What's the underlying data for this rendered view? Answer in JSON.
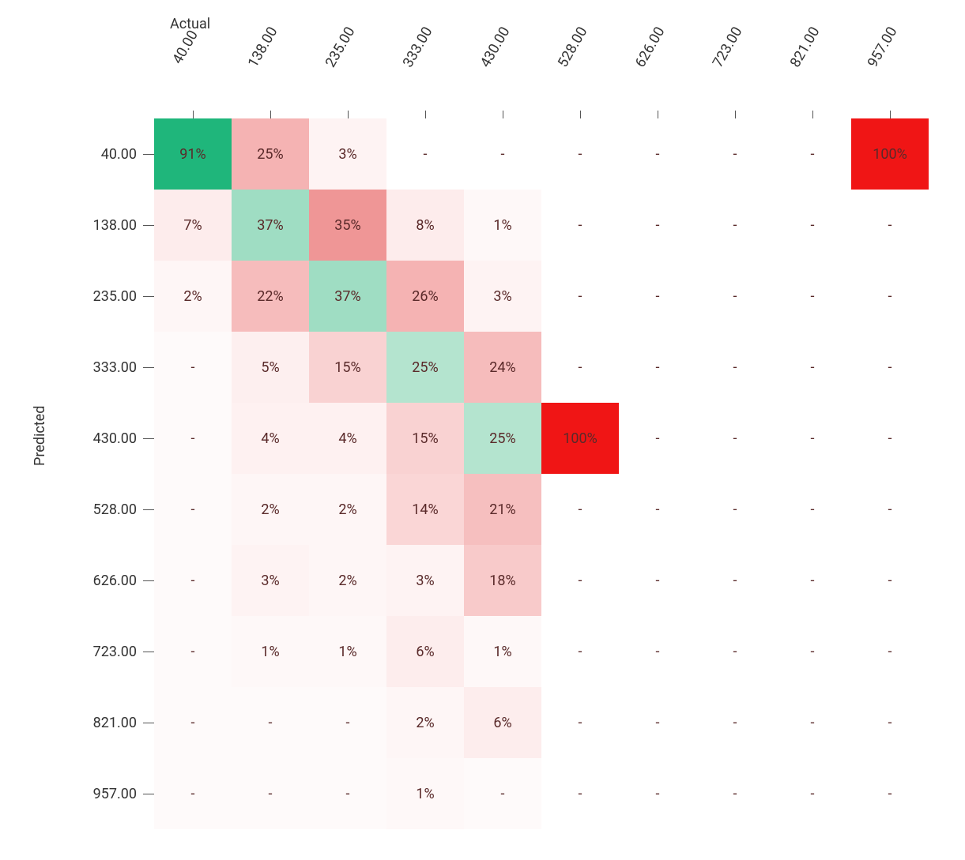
{
  "chart_data": {
    "type": "heatmap",
    "x_axis_title": "Actual",
    "y_axis_title": "Predicted",
    "x_categories": [
      "40.00",
      "138.00",
      "235.00",
      "333.00",
      "430.00",
      "528.00",
      "626.00",
      "723.00",
      "821.00",
      "957.00"
    ],
    "y_categories": [
      "40.00",
      "138.00",
      "235.00",
      "333.00",
      "430.00",
      "528.00",
      "626.00",
      "723.00",
      "821.00",
      "957.00"
    ],
    "cells": [
      [
        {
          "label": "91%",
          "value": 91,
          "bg": "#1fb67b",
          "diagonal": true
        },
        {
          "label": "25%",
          "value": 25,
          "bg": "#f5b3b3"
        },
        {
          "label": "3%",
          "value": 3,
          "bg": "#fef3f3"
        },
        {
          "label": "-",
          "value": null,
          "bg": "#fff"
        },
        {
          "label": "-",
          "value": null,
          "bg": "#fff"
        },
        {
          "label": "-",
          "value": null,
          "bg": "#fff"
        },
        {
          "label": "-",
          "value": null,
          "bg": "#fff"
        },
        {
          "label": "-",
          "value": null,
          "bg": "#fff"
        },
        {
          "label": "-",
          "value": null,
          "bg": "#fff"
        },
        {
          "label": "100%",
          "value": 100,
          "bg": "#f01515"
        }
      ],
      [
        {
          "label": "7%",
          "value": 7,
          "bg": "#fdecec"
        },
        {
          "label": "37%",
          "value": 37,
          "bg": "#9fddc3",
          "diagonal": true
        },
        {
          "label": "35%",
          "value": 35,
          "bg": "#ef9696"
        },
        {
          "label": "8%",
          "value": 8,
          "bg": "#fdecec"
        },
        {
          "label": "1%",
          "value": 1,
          "bg": "#fef8f8"
        },
        {
          "label": "-",
          "value": null,
          "bg": "#fff"
        },
        {
          "label": "-",
          "value": null,
          "bg": "#fff"
        },
        {
          "label": "-",
          "value": null,
          "bg": "#fff"
        },
        {
          "label": "-",
          "value": null,
          "bg": "#fff"
        },
        {
          "label": "-",
          "value": null,
          "bg": "#fff"
        }
      ],
      [
        {
          "label": "2%",
          "value": 2,
          "bg": "#fef6f6"
        },
        {
          "label": "22%",
          "value": 22,
          "bg": "#f6bcbc"
        },
        {
          "label": "37%",
          "value": 37,
          "bg": "#9fddc3",
          "diagonal": true
        },
        {
          "label": "26%",
          "value": 26,
          "bg": "#f5b3b3"
        },
        {
          "label": "3%",
          "value": 3,
          "bg": "#fef3f3"
        },
        {
          "label": "-",
          "value": null,
          "bg": "#fff"
        },
        {
          "label": "-",
          "value": null,
          "bg": "#fff"
        },
        {
          "label": "-",
          "value": null,
          "bg": "#fff"
        },
        {
          "label": "-",
          "value": null,
          "bg": "#fff"
        },
        {
          "label": "-",
          "value": null,
          "bg": "#fff"
        }
      ],
      [
        {
          "label": "-",
          "value": null,
          "bg": "#fefafa"
        },
        {
          "label": "5%",
          "value": 5,
          "bg": "#fdefef"
        },
        {
          "label": "15%",
          "value": 15,
          "bg": "#f9d2d2"
        },
        {
          "label": "25%",
          "value": 25,
          "bg": "#b4e4cf",
          "diagonal": true
        },
        {
          "label": "24%",
          "value": 24,
          "bg": "#f6bcbc"
        },
        {
          "label": "-",
          "value": null,
          "bg": "#fff"
        },
        {
          "label": "-",
          "value": null,
          "bg": "#fff"
        },
        {
          "label": "-",
          "value": null,
          "bg": "#fff"
        },
        {
          "label": "-",
          "value": null,
          "bg": "#fff"
        },
        {
          "label": "-",
          "value": null,
          "bg": "#fff"
        }
      ],
      [
        {
          "label": "-",
          "value": null,
          "bg": "#fefafa"
        },
        {
          "label": "4%",
          "value": 4,
          "bg": "#fef1f1"
        },
        {
          "label": "4%",
          "value": 4,
          "bg": "#fef1f1"
        },
        {
          "label": "15%",
          "value": 15,
          "bg": "#f9d2d2"
        },
        {
          "label": "25%",
          "value": 25,
          "bg": "#b4e4cf",
          "diagonal": true
        },
        {
          "label": "100%",
          "value": 100,
          "bg": "#f01515"
        },
        {
          "label": "-",
          "value": null,
          "bg": "#fff"
        },
        {
          "label": "-",
          "value": null,
          "bg": "#fff"
        },
        {
          "label": "-",
          "value": null,
          "bg": "#fff"
        },
        {
          "label": "-",
          "value": null,
          "bg": "#fff"
        }
      ],
      [
        {
          "label": "-",
          "value": null,
          "bg": "#fefafa"
        },
        {
          "label": "2%",
          "value": 2,
          "bg": "#fef6f6"
        },
        {
          "label": "2%",
          "value": 2,
          "bg": "#fef6f6"
        },
        {
          "label": "14%",
          "value": 14,
          "bg": "#fad6d6"
        },
        {
          "label": "21%",
          "value": 21,
          "bg": "#f6bfbf"
        },
        {
          "label": "-",
          "value": null,
          "bg": "#fff",
          "diagonal": true
        },
        {
          "label": "-",
          "value": null,
          "bg": "#fff"
        },
        {
          "label": "-",
          "value": null,
          "bg": "#fff"
        },
        {
          "label": "-",
          "value": null,
          "bg": "#fff"
        },
        {
          "label": "-",
          "value": null,
          "bg": "#fff"
        }
      ],
      [
        {
          "label": "-",
          "value": null,
          "bg": "#fefafa"
        },
        {
          "label": "3%",
          "value": 3,
          "bg": "#fef3f3"
        },
        {
          "label": "2%",
          "value": 2,
          "bg": "#fef6f6"
        },
        {
          "label": "3%",
          "value": 3,
          "bg": "#fef3f3"
        },
        {
          "label": "18%",
          "value": 18,
          "bg": "#f8caca"
        },
        {
          "label": "-",
          "value": null,
          "bg": "#fff"
        },
        {
          "label": "-",
          "value": null,
          "bg": "#fff",
          "diagonal": true
        },
        {
          "label": "-",
          "value": null,
          "bg": "#fff"
        },
        {
          "label": "-",
          "value": null,
          "bg": "#fff"
        },
        {
          "label": "-",
          "value": null,
          "bg": "#fff"
        }
      ],
      [
        {
          "label": "-",
          "value": null,
          "bg": "#fefafa"
        },
        {
          "label": "1%",
          "value": 1,
          "bg": "#fef8f8"
        },
        {
          "label": "1%",
          "value": 1,
          "bg": "#fef8f8"
        },
        {
          "label": "6%",
          "value": 6,
          "bg": "#fdeded"
        },
        {
          "label": "1%",
          "value": 1,
          "bg": "#fef8f8"
        },
        {
          "label": "-",
          "value": null,
          "bg": "#fff"
        },
        {
          "label": "-",
          "value": null,
          "bg": "#fff"
        },
        {
          "label": "-",
          "value": null,
          "bg": "#fff",
          "diagonal": true
        },
        {
          "label": "-",
          "value": null,
          "bg": "#fff"
        },
        {
          "label": "-",
          "value": null,
          "bg": "#fff"
        }
      ],
      [
        {
          "label": "-",
          "value": null,
          "bg": "#fefafa"
        },
        {
          "label": "-",
          "value": null,
          "bg": "#fefafa"
        },
        {
          "label": "-",
          "value": null,
          "bg": "#fefafa"
        },
        {
          "label": "2%",
          "value": 2,
          "bg": "#fef6f6"
        },
        {
          "label": "6%",
          "value": 6,
          "bg": "#fdeded"
        },
        {
          "label": "-",
          "value": null,
          "bg": "#fff"
        },
        {
          "label": "-",
          "value": null,
          "bg": "#fff"
        },
        {
          "label": "-",
          "value": null,
          "bg": "#fff"
        },
        {
          "label": "-",
          "value": null,
          "bg": "#fff",
          "diagonal": true
        },
        {
          "label": "-",
          "value": null,
          "bg": "#fff"
        }
      ],
      [
        {
          "label": "-",
          "value": null,
          "bg": "#fefafa"
        },
        {
          "label": "-",
          "value": null,
          "bg": "#fefafa"
        },
        {
          "label": "-",
          "value": null,
          "bg": "#fefafa"
        },
        {
          "label": "1%",
          "value": 1,
          "bg": "#fef8f8"
        },
        {
          "label": "-",
          "value": null,
          "bg": "#fefafa"
        },
        {
          "label": "-",
          "value": null,
          "bg": "#fff"
        },
        {
          "label": "-",
          "value": null,
          "bg": "#fff"
        },
        {
          "label": "-",
          "value": null,
          "bg": "#fff"
        },
        {
          "label": "-",
          "value": null,
          "bg": "#fff"
        },
        {
          "label": "-",
          "value": null,
          "bg": "#fff",
          "diagonal": true
        }
      ]
    ]
  }
}
